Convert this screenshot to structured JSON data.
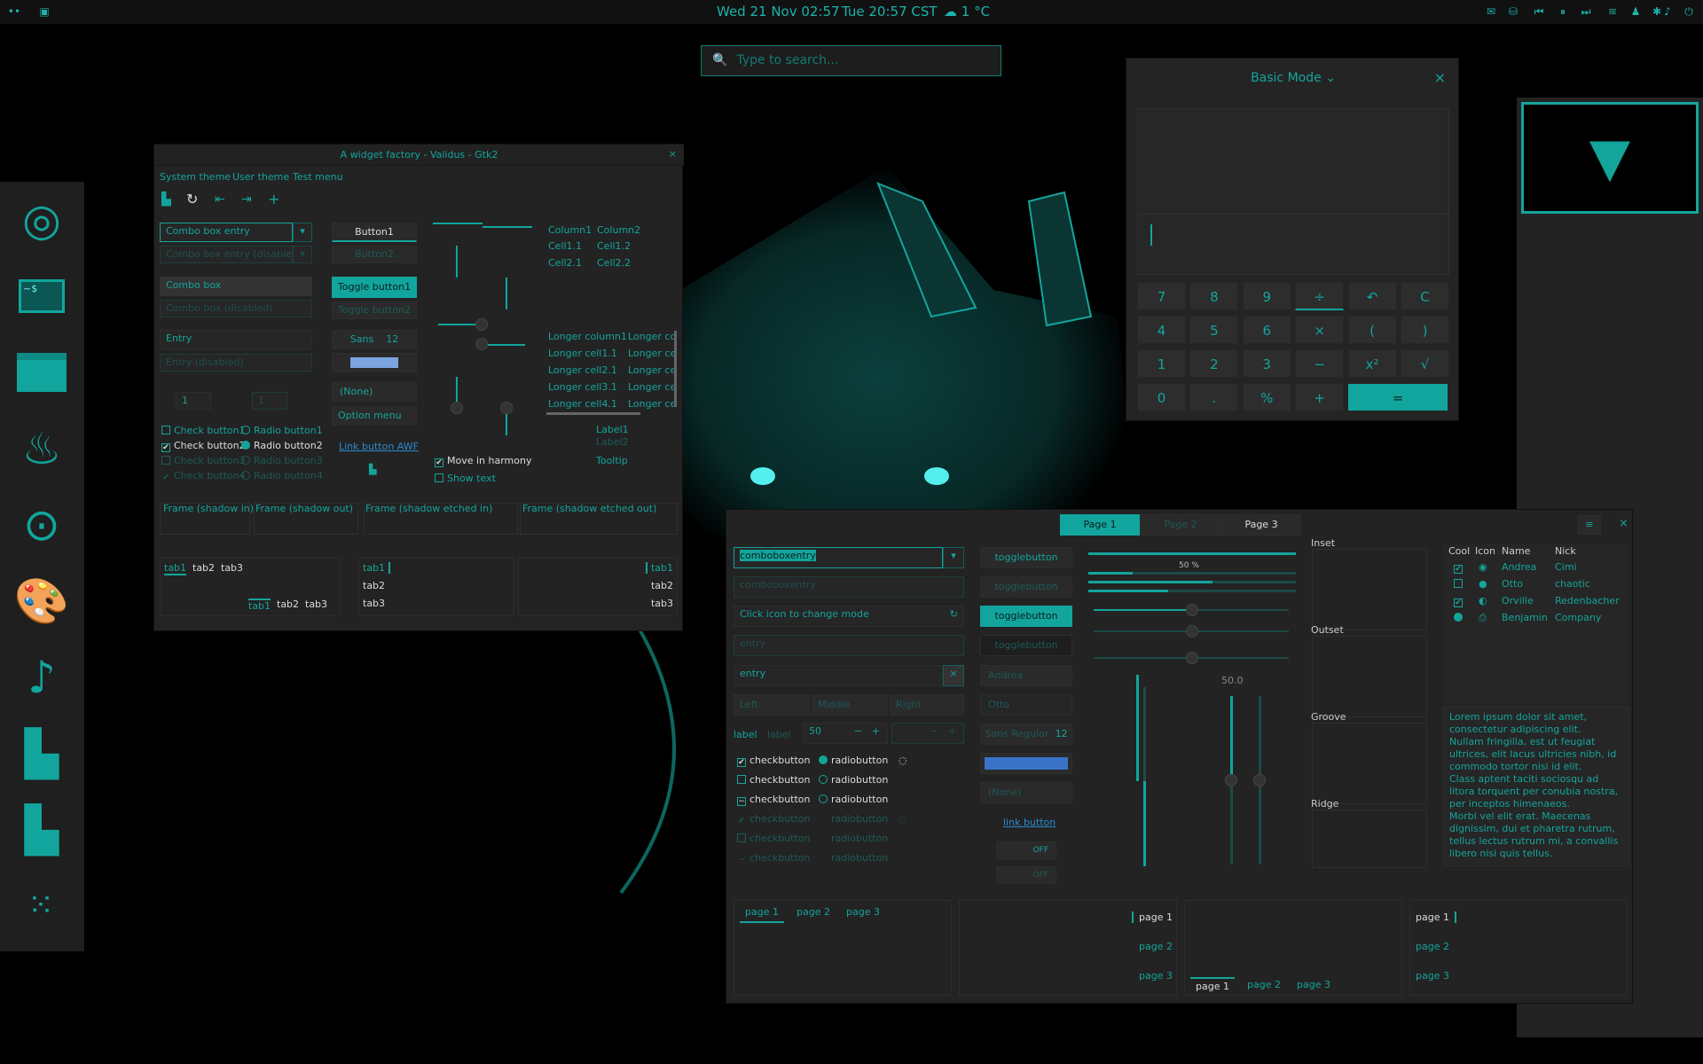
{
  "topbar": {
    "clock": "Wed 21 Nov  02:57",
    "world_clock": "Tue 20:57 CST",
    "weather": "☁ 1 °C"
  },
  "search": {
    "placeholder": "Type to search..."
  },
  "dock": {
    "items": [
      "chrome-icon",
      "terminal-icon",
      "files-icon",
      "genie-icon",
      "game-icon",
      "palette-icon",
      "music-icon",
      "factory-icon",
      "factory2-icon",
      "apps-grid-icon"
    ]
  },
  "wf": {
    "title": "A widget factory - Validus - Gtk2",
    "close": "×",
    "menu": [
      "System theme",
      "User theme",
      "Test menu"
    ],
    "combo_entry": "Combo box entry",
    "combo_entry_dis": "Combo box entry (disabled)",
    "combo": "Combo box",
    "combo_dis": "Combo box (disabled)",
    "entry": "Entry",
    "entry_dis": "Entry (disabled)",
    "spin1": "1",
    "spin2": "1",
    "checks": [
      "Check button1",
      "Check button2",
      "Check button3",
      "Check button4"
    ],
    "radios": [
      "Radio button1",
      "Radio button2",
      "Radio button3",
      "Radio button4"
    ],
    "button1": "Button1",
    "button2": "Button2",
    "toggle1": "Toggle button1",
    "toggle2": "Toggle button2",
    "font": "Sans",
    "font_size": "12",
    "none": "(None)",
    "option": "Option menu",
    "link": "Link button AWF",
    "move": "Move in harmony",
    "show": "Show text",
    "tree1_cols": [
      "Column1",
      "Column2"
    ],
    "tree1_rows": [
      [
        "Cell1.1",
        "Cell1.2"
      ],
      [
        "Cell2.1",
        "Cell2.2"
      ]
    ],
    "tree2_cols": [
      "Longer column1",
      "Longer co"
    ],
    "tree2_rows": [
      [
        "Longer cell1.1",
        "Longer ce"
      ],
      [
        "Longer cell2.1",
        "Longer ce"
      ],
      [
        "Longer cell3.1",
        "Longer ce"
      ],
      [
        "Longer cell4.1",
        "Longer ce"
      ]
    ],
    "label1": "Label1",
    "label2": "Label2",
    "tooltip": "Tooltip",
    "frames": [
      "Frame (shadow in)",
      "Frame (shadow out)",
      "Frame (shadow etched in)",
      "Frame (shadow etched out)"
    ],
    "tabs": [
      "tab1",
      "tab2",
      "tab3"
    ]
  },
  "calc": {
    "title": "Basic Mode",
    "close": "×",
    "keys": [
      [
        "7",
        "8",
        "9",
        "÷",
        "↶",
        "C"
      ],
      [
        "4",
        "5",
        "6",
        "×",
        "(",
        ")"
      ],
      [
        "1",
        "2",
        "3",
        "−",
        "x²",
        "√"
      ],
      [
        "0",
        ".",
        "%",
        "+",
        "="
      ]
    ]
  },
  "gtk3": {
    "tabs": [
      "Page 1",
      "Page 2",
      "Page 3"
    ],
    "combo1": "comboboxentry",
    "combo2": "comboboxentry",
    "icon_entry": "Click icon to change mode",
    "entry1": "entry",
    "entry2": "entry",
    "seg": [
      "Left",
      "Middle",
      "Right"
    ],
    "label1": "label",
    "label2": "label",
    "spin": "50",
    "check": "checkbutton",
    "radio": "radiobutton",
    "toggle": "togglebutton",
    "combo_andrea": "Andrea",
    "combo_otto": "Otto",
    "font": "Sans Regular",
    "font_size": "12",
    "none": "(None)",
    "link": "link button",
    "off": "OFF",
    "progress": "50 %",
    "scale_val": "50.0",
    "frames": [
      "Inset",
      "Outset",
      "Groove",
      "Ridge"
    ],
    "tree_cols": [
      "Cool",
      "Icon",
      "Name",
      "Nick"
    ],
    "tree_rows": [
      [
        "Andrea",
        "Cimi"
      ],
      [
        "Otto",
        "chaotic"
      ],
      [
        "Orville",
        "Redenbacher"
      ],
      [
        "Benjamin",
        "Company"
      ]
    ],
    "lorem": "Lorem ipsum dolor sit amet, consectetur adipiscing elit.\nNullam fringilla, est ut feugiat ultrices, elit lacus ultricies nibh, id commodo tortor nisi id elit.\nClass aptent taciti sociosqu ad litora torquent per conubia nostra, per inceptos himenaeos.\nMorbi vel elit erat. Maecenas dignissim, dui et pharetra rutrum, tellus lectus rutrum mi, a convallis libero nisi quis tellus.",
    "pages": [
      "page 1",
      "page 2",
      "page 3"
    ]
  }
}
